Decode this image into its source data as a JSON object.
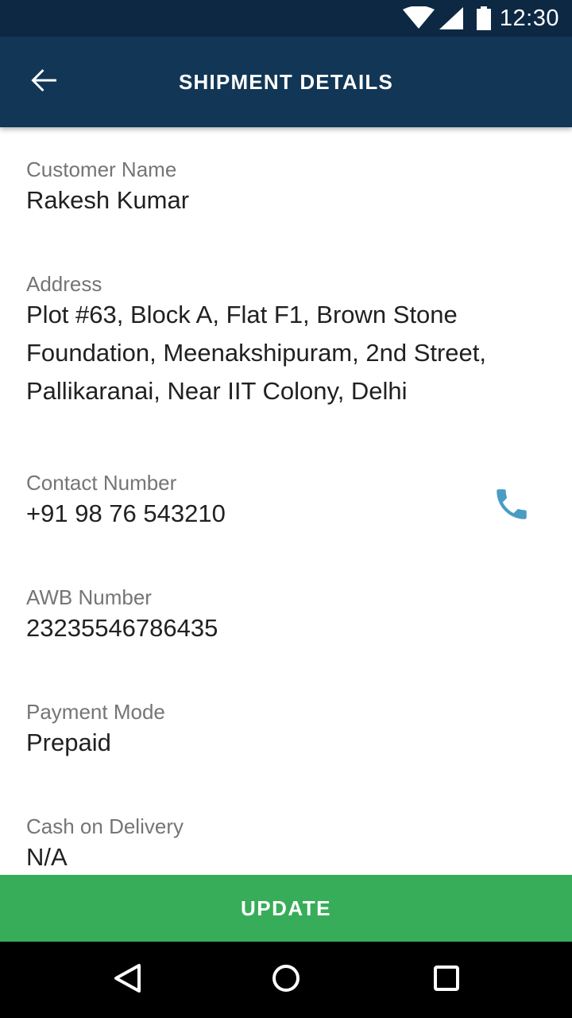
{
  "status_bar": {
    "time": "12:30",
    "icons": [
      "wifi-icon",
      "cell-signal-icon",
      "battery-icon"
    ]
  },
  "app_bar": {
    "title": "SHIPMENT DETAILS",
    "back_icon": "arrow-back-icon"
  },
  "fields": {
    "customer_name": {
      "label": "Customer Name",
      "value": "Rakesh Kumar"
    },
    "address": {
      "label": "Address",
      "value": "Plot #63, Block A, Flat F1, Brown Stone Foundation, Meenakshipuram, 2nd Street, Pallikaranai, Near IIT Colony, Delhi"
    },
    "contact_number": {
      "label": "Contact Number",
      "value": "+91 98 76 543210",
      "action_icon": "phone-icon"
    },
    "awb_number": {
      "label": "AWB Number",
      "value": "23235546786435"
    },
    "payment_mode": {
      "label": "Payment Mode",
      "value": "Prepaid"
    },
    "cash_on_delivery": {
      "label": "Cash on Delivery",
      "value": "N/A"
    }
  },
  "footer": {
    "update_label": "UPDATE"
  },
  "nav_bar": {
    "icons": [
      "back-triangle-icon",
      "home-circle-icon",
      "recents-square-icon"
    ]
  },
  "colors": {
    "status_bar": "#0c2843",
    "app_bar": "#123655",
    "update_button": "#37ad5a",
    "phone_icon": "#4a9cc4",
    "label_text": "#757575",
    "value_text": "#212121"
  }
}
